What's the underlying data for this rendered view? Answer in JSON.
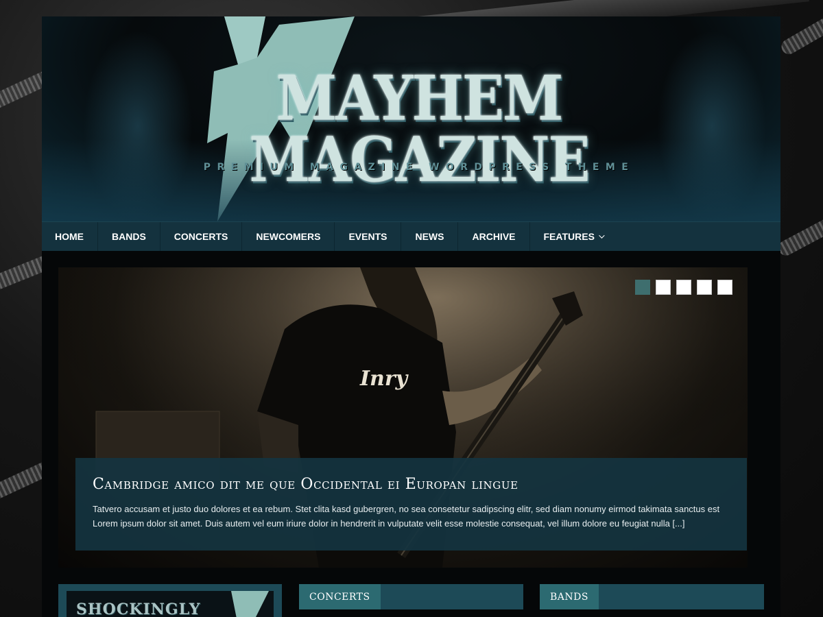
{
  "header": {
    "title": "MAYHEM MAGAZINE",
    "tagline": "PREMIUM MAGAZINE WORDPRESS THEME"
  },
  "nav": {
    "items": [
      {
        "label": "HOME"
      },
      {
        "label": "BANDS"
      },
      {
        "label": "CONCERTS"
      },
      {
        "label": "NEWCOMERS"
      },
      {
        "label": "EVENTS"
      },
      {
        "label": "NEWS"
      },
      {
        "label": "ARCHIVE"
      },
      {
        "label": "FEATURES"
      }
    ]
  },
  "slider": {
    "dot_count": 5,
    "active_dot": 1,
    "shirt_text": "Inry",
    "caption": {
      "title": "Cambridge amico dit me que Occidental ei Europan lingue",
      "excerpt": "Tatvero accusam et justo duo dolores et ea rebum. Stet clita kasd gubergren, no sea consetetur sadipscing elitr, sed diam nonumy eirmod takimata sanctus est Lorem ipsum dolor sit amet. Duis autem vel eum iriure dolor in hendrerit in vulputate velit esse molestie consequat, vel illum dolore eu feugiat nulla [...]"
    }
  },
  "widgets": {
    "thumb_text": "SHOCKINGLY AWESOME",
    "concerts_label": "CONCERTS",
    "bands_label": "BANDS"
  },
  "colors": {
    "nav_bg": "#14323e",
    "caption_bg": "#143440",
    "accent": "#2c6a71",
    "bolt": "#8fbdb6"
  },
  "icons": {
    "features_dropdown": "chevron-down-icon"
  }
}
